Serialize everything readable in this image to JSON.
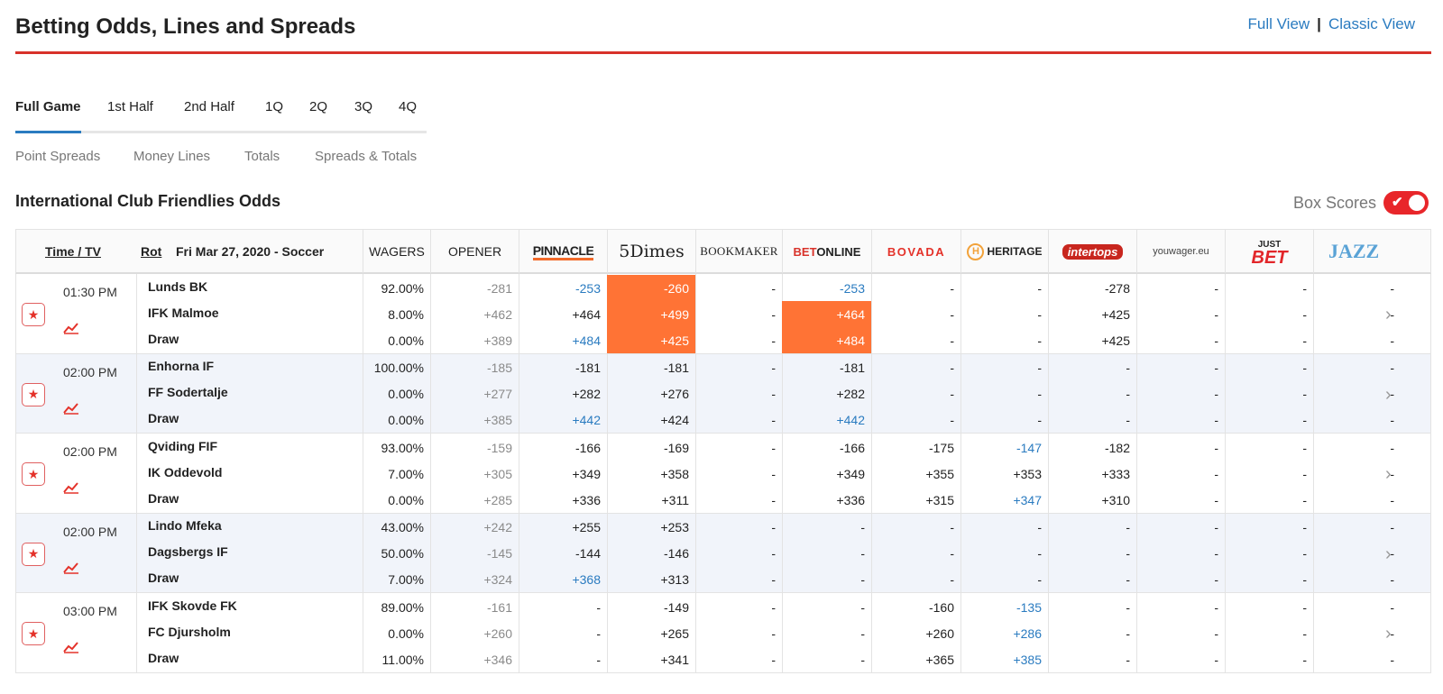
{
  "header": {
    "title": "Betting Odds, Lines and Spreads",
    "links": [
      "Full View",
      "Classic View"
    ],
    "separator": "|"
  },
  "period_tabs": [
    "Full Game",
    "1st Half",
    "2nd Half",
    "1Q",
    "2Q",
    "3Q",
    "4Q"
  ],
  "active_period": "Full Game",
  "market_tabs": [
    "Point Spreads",
    "Money Lines",
    "Totals",
    "Spreads & Totals"
  ],
  "league": {
    "title": "International Club Friendlies Odds",
    "box_scores_label": "Box Scores",
    "box_scores_on": true
  },
  "table_header": {
    "time_tv": "Time / TV",
    "rot": "Rot",
    "date_sport": "Fri Mar 27, 2020 - Soccer",
    "wagers": "WAGERS",
    "opener": "OPENER"
  },
  "sportsbooks": [
    {
      "name": "PINNACLE",
      "logo": "pinnacle-logo"
    },
    {
      "name": "5Dimes",
      "logo": "5dimes-logo"
    },
    {
      "name": "BOOKMAKER",
      "logo": "bookmaker-logo"
    },
    {
      "name": "BETONLINE",
      "logo": "betonline-logo"
    },
    {
      "name": "BOVADA",
      "logo": "bovada-logo"
    },
    {
      "name": "HERITAGE",
      "logo": "heritage-logo"
    },
    {
      "name": "intertops",
      "logo": "intertops-logo"
    },
    {
      "name": "youwager.eu",
      "logo": "youwager-logo"
    },
    {
      "name": "JUST BET",
      "logo": "justbet-logo"
    },
    {
      "name": "JAZZ",
      "logo": "jazz-logo"
    }
  ],
  "colors": {
    "accent_red": "#d8322a",
    "link_blue": "#2a7bc0",
    "highlight_orange": "#ff7335",
    "alt_row": "#f1f4fa"
  },
  "games": [
    {
      "time": "01:30 PM",
      "rows": [
        {
          "team": "Lunds BK",
          "wagers": "92.00%",
          "opener": "-281",
          "odds": [
            "-253",
            "-260",
            "-",
            "-253",
            "-",
            "-",
            "-278",
            "-",
            "-",
            "-"
          ],
          "blue": [
            0,
            3
          ],
          "highlight": [
            1
          ]
        },
        {
          "team": "IFK Malmoe",
          "wagers": "8.00%",
          "opener": "+462",
          "odds": [
            "+464",
            "+499",
            "-",
            "+464",
            "-",
            "-",
            "+425",
            "-",
            "-",
            "-"
          ],
          "blue": [],
          "highlight": [
            1,
            3
          ]
        },
        {
          "team": "Draw",
          "wagers": "0.00%",
          "opener": "+389",
          "odds": [
            "+484",
            "+425",
            "-",
            "+484",
            "-",
            "-",
            "+425",
            "-",
            "-",
            "-"
          ],
          "blue": [
            0
          ],
          "highlight": [
            1,
            3
          ]
        }
      ]
    },
    {
      "time": "02:00 PM",
      "rows": [
        {
          "team": "Enhorna IF",
          "wagers": "100.00%",
          "opener": "-185",
          "odds": [
            "-181",
            "-181",
            "-",
            "-181",
            "-",
            "-",
            "-",
            "-",
            "-",
            "-"
          ],
          "blue": [],
          "highlight": []
        },
        {
          "team": "FF Sodertalje",
          "wagers": "0.00%",
          "opener": "+277",
          "odds": [
            "+282",
            "+276",
            "-",
            "+282",
            "-",
            "-",
            "-",
            "-",
            "-",
            "-"
          ],
          "blue": [],
          "highlight": []
        },
        {
          "team": "Draw",
          "wagers": "0.00%",
          "opener": "+385",
          "odds": [
            "+442",
            "+424",
            "-",
            "+442",
            "-",
            "-",
            "-",
            "-",
            "-",
            "-"
          ],
          "blue": [
            0,
            3
          ],
          "highlight": []
        }
      ]
    },
    {
      "time": "02:00 PM",
      "rows": [
        {
          "team": "Qviding FIF",
          "wagers": "93.00%",
          "opener": "-159",
          "odds": [
            "-166",
            "-169",
            "-",
            "-166",
            "-175",
            "-147",
            "-182",
            "-",
            "-",
            "-"
          ],
          "blue": [
            5
          ],
          "highlight": []
        },
        {
          "team": "IK Oddevold",
          "wagers": "7.00%",
          "opener": "+305",
          "odds": [
            "+349",
            "+358",
            "-",
            "+349",
            "+355",
            "+353",
            "+333",
            "-",
            "-",
            "-"
          ],
          "blue": [],
          "highlight": []
        },
        {
          "team": "Draw",
          "wagers": "0.00%",
          "opener": "+285",
          "odds": [
            "+336",
            "+311",
            "-",
            "+336",
            "+315",
            "+347",
            "+310",
            "-",
            "-",
            "-"
          ],
          "blue": [
            5
          ],
          "highlight": []
        }
      ]
    },
    {
      "time": "02:00 PM",
      "rows": [
        {
          "team": "Lindo Mfeka",
          "wagers": "43.00%",
          "opener": "+242",
          "odds": [
            "+255",
            "+253",
            "-",
            "-",
            "-",
            "-",
            "-",
            "-",
            "-",
            "-"
          ],
          "blue": [],
          "highlight": []
        },
        {
          "team": "Dagsbergs IF",
          "wagers": "50.00%",
          "opener": "-145",
          "odds": [
            "-144",
            "-146",
            "-",
            "-",
            "-",
            "-",
            "-",
            "-",
            "-",
            "-"
          ],
          "blue": [],
          "highlight": []
        },
        {
          "team": "Draw",
          "wagers": "7.00%",
          "opener": "+324",
          "odds": [
            "+368",
            "+313",
            "-",
            "-",
            "-",
            "-",
            "-",
            "-",
            "-",
            "-"
          ],
          "blue": [
            0
          ],
          "highlight": []
        }
      ]
    },
    {
      "time": "03:00 PM",
      "rows": [
        {
          "team": "IFK Skovde FK",
          "wagers": "89.00%",
          "opener": "-161",
          "odds": [
            "-",
            "-149",
            "-",
            "-",
            "-160",
            "-135",
            "-",
            "-",
            "-",
            "-"
          ],
          "blue": [
            5
          ],
          "highlight": []
        },
        {
          "team": "FC Djursholm",
          "wagers": "0.00%",
          "opener": "+260",
          "odds": [
            "-",
            "+265",
            "-",
            "-",
            "+260",
            "+286",
            "-",
            "-",
            "-",
            "-"
          ],
          "blue": [
            5
          ],
          "highlight": []
        },
        {
          "team": "Draw",
          "wagers": "11.00%",
          "opener": "+346",
          "odds": [
            "-",
            "+341",
            "-",
            "-",
            "+365",
            "+385",
            "-",
            "-",
            "-",
            "-"
          ],
          "blue": [
            5
          ],
          "highlight": []
        }
      ]
    }
  ]
}
